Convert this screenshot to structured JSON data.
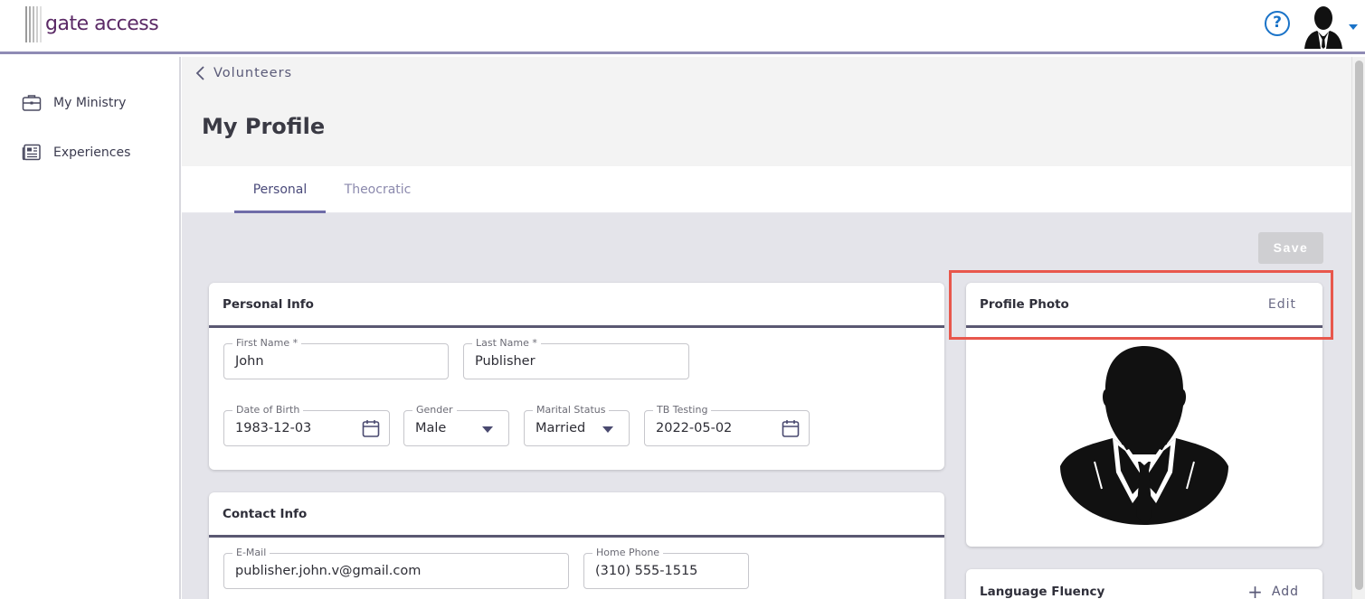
{
  "app": {
    "logo_text": "gate access"
  },
  "header": {
    "help_icon": "question-circle-icon",
    "avatar_icon": "user-avatar-icon"
  },
  "sidebar": {
    "items": [
      {
        "label": "My Ministry",
        "icon": "briefcase-icon"
      },
      {
        "label": "Experiences",
        "icon": "newspaper-icon"
      }
    ]
  },
  "breadcrumb": {
    "back_label": "Volunteers"
  },
  "page": {
    "title": "My Profile"
  },
  "tabs": [
    {
      "label": "Personal",
      "active": true
    },
    {
      "label": "Theocratic",
      "active": false
    }
  ],
  "toolbar": {
    "save_label": "Save"
  },
  "personal_info": {
    "title": "Personal Info",
    "first_name": {
      "label": "First Name *",
      "value": "John"
    },
    "last_name": {
      "label": "Last Name *",
      "value": "Publisher"
    },
    "dob": {
      "label": "Date of Birth",
      "value": "1983-12-03"
    },
    "gender": {
      "label": "Gender",
      "value": "Male"
    },
    "marital": {
      "label": "Marital Status",
      "value": "Married"
    },
    "tb": {
      "label": "TB Testing",
      "value": "2022-05-02"
    }
  },
  "contact_info": {
    "title": "Contact Info",
    "email": {
      "label": "E-Mail",
      "value": "publisher.john.v@gmail.com"
    },
    "home_phone": {
      "label": "Home Phone",
      "value": "(310) 555-1515"
    }
  },
  "profile_photo": {
    "title": "Profile Photo",
    "edit_label": "Edit"
  },
  "language": {
    "title": "Language Fluency",
    "add_label": "Add"
  },
  "colors": {
    "accent": "#6f6ca8",
    "link_blue": "#1a73c8",
    "highlight": "#e8574c",
    "brand": "#5b2a66"
  }
}
